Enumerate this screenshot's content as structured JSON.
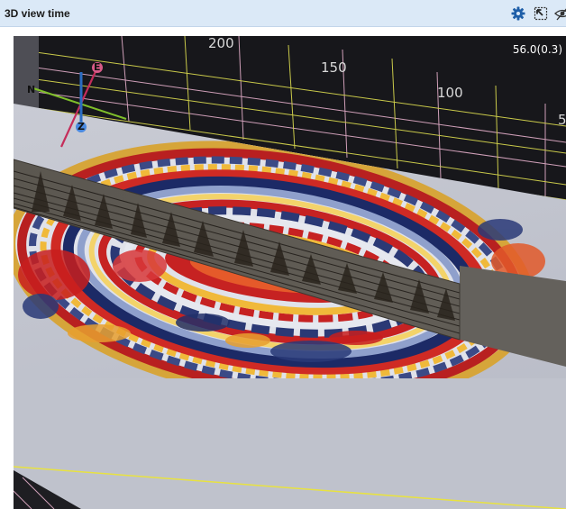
{
  "window": {
    "title": "3D view time",
    "buttons": [
      {
        "name": "settings",
        "icon": "gear-icon"
      },
      {
        "name": "pop-out",
        "icon": "pop-out-icon"
      },
      {
        "name": "visibility",
        "icon": "eye-icon"
      }
    ]
  },
  "viewport": {
    "readout": "56.0(0.3)",
    "grid_labels": [
      "200",
      "150",
      "100",
      "5"
    ],
    "orientation_axes": {
      "north": "N",
      "east": "E",
      "z": "Z"
    }
  },
  "colors": {
    "titlebar_bg": "#dbe9f7",
    "accent": "#1f5fa8",
    "grid_yellow": "#c9c94a",
    "grid_pink": "#cf9fb8",
    "floor": "#bfc2cc",
    "seismic_red": "#c81e1e",
    "seismic_blue": "#22306a",
    "seismic_yellow": "#f0b93a"
  }
}
